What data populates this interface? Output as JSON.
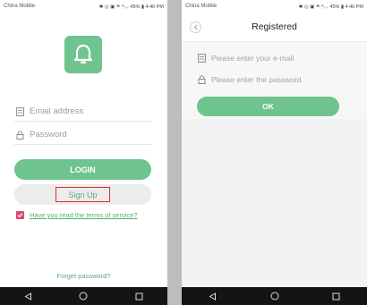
{
  "status_bar": {
    "carrier": "China Mobile",
    "indicators": "✱ ◎ ▣ ≗ ᴴ⸝⸝ 45% ▮ 4:40 PM"
  },
  "login": {
    "email_placeholder": "Email address",
    "password_placeholder": "Password",
    "login_label": "LOGIN",
    "signup_label": "Sign Up",
    "terms_label": "Have you read the terms of service?",
    "forgot_label": "Forget password?"
  },
  "register": {
    "title": "Registered",
    "email_placeholder": "Please enter your e-mail",
    "password_placeholder": "Please enter the password",
    "ok_label": "OK"
  },
  "colors": {
    "accent_green": "#6fc38f",
    "checkbox_pink": "#d94a6e",
    "highlight_red": "#d9302a",
    "nav_bar": "#141414"
  },
  "icons": {
    "logo": "bell-icon",
    "email": "email-icon",
    "password": "lock-icon",
    "back": "chevron-left-icon",
    "nav": [
      "back-triangle-icon",
      "home-circle-icon",
      "recents-square-icon"
    ]
  }
}
